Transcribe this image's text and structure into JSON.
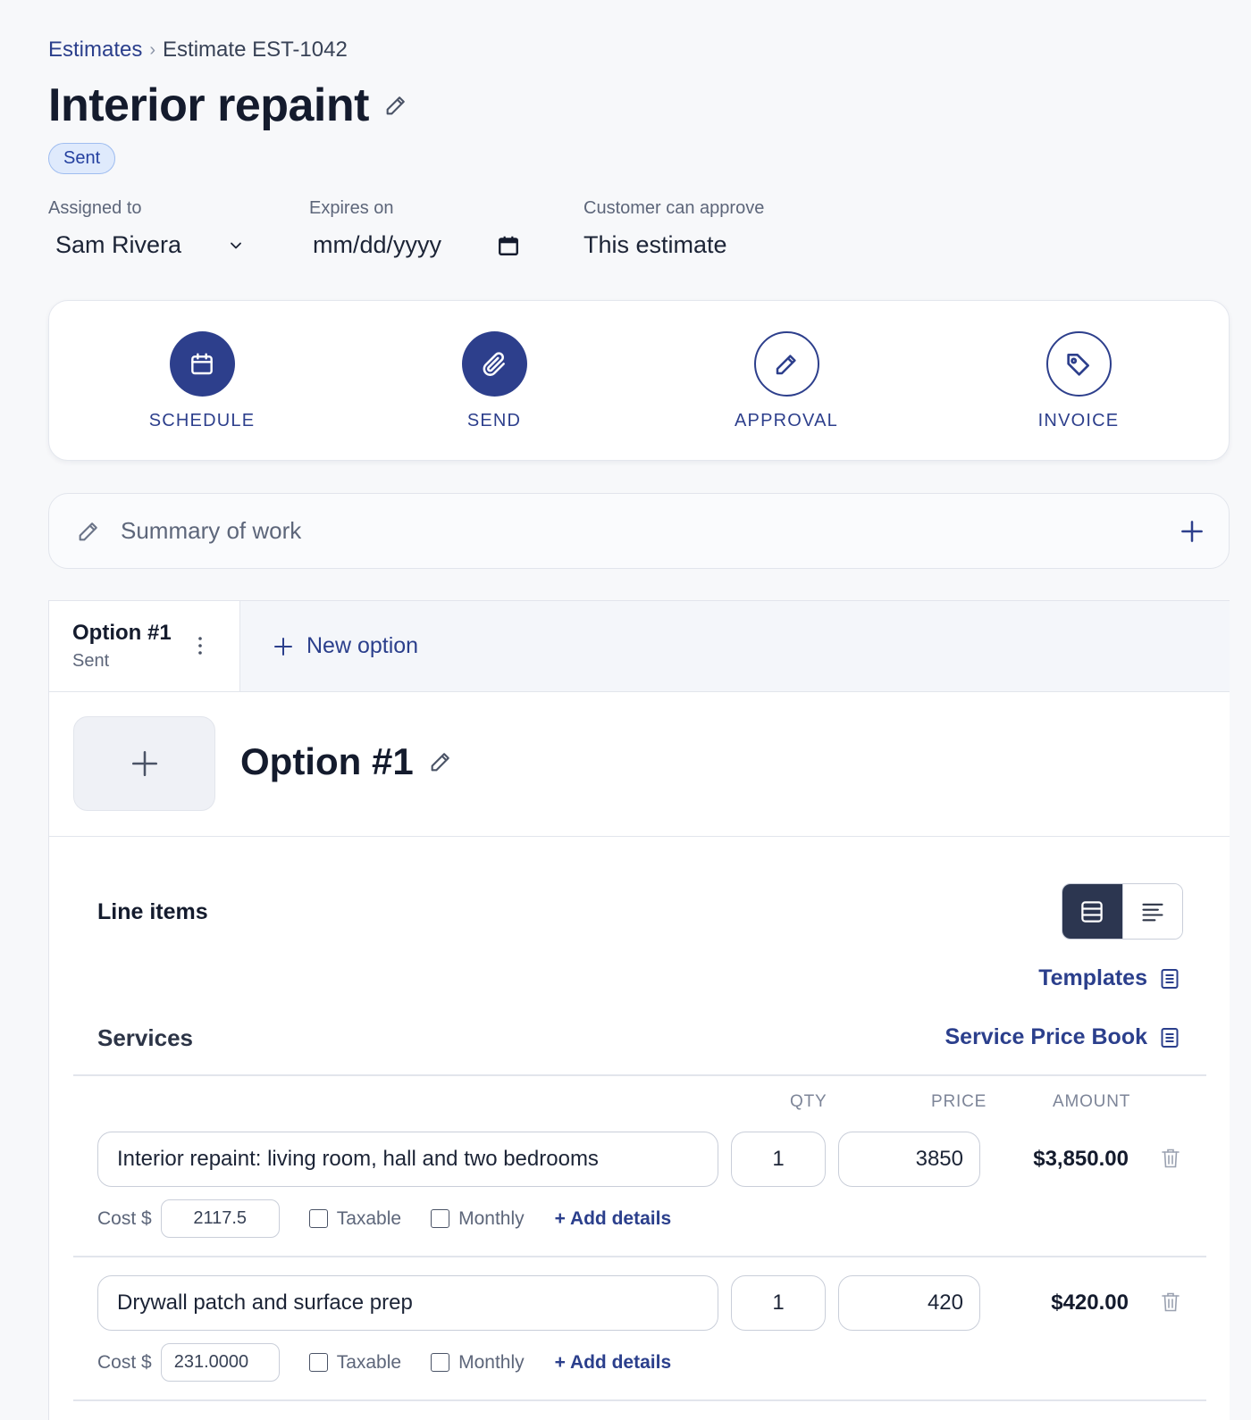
{
  "breadcrumb": {
    "parent": "Estimates",
    "separator": "›",
    "current": "Estimate EST-1042"
  },
  "page_title": "Interior repaint",
  "status": "Sent",
  "meta": {
    "assigned_label": "Assigned to",
    "assigned_value": "Sam Rivera",
    "expires_label": "Expires on",
    "expires_placeholder": "mm/dd/yyyy",
    "approve_label": "Customer can approve",
    "approve_value": "This estimate"
  },
  "actions": [
    {
      "label": "SCHEDULE",
      "icon": "calendar-icon"
    },
    {
      "label": "SEND",
      "icon": "paperclip-icon"
    },
    {
      "label": "APPROVAL",
      "icon": "pencil-icon"
    },
    {
      "label": "INVOICE",
      "icon": "tag-icon"
    }
  ],
  "summary": {
    "placeholder": "Summary of work"
  },
  "tabs": {
    "active": {
      "name": "Option #1",
      "status": "Sent"
    },
    "new_option": "New option"
  },
  "option": {
    "title": "Option #1"
  },
  "line_items": {
    "label": "Line items",
    "templates_link": "Templates",
    "services_label": "Services",
    "price_book_link": "Service Price Book",
    "columns": {
      "qty": "QTY",
      "price": "PRICE",
      "amount": "AMOUNT"
    },
    "items": [
      {
        "name": "Interior repaint: living room, hall and two bedrooms",
        "qty": "1",
        "price": "3850",
        "amount": "$3,850.00",
        "cost_label": "Cost $",
        "cost": "2117.5",
        "taxable_label": "Taxable",
        "monthly_label": "Monthly",
        "add_details": "+ Add details"
      },
      {
        "name": "Drywall patch and surface prep",
        "qty": "1",
        "price": "420",
        "amount": "$420.00",
        "cost_label": "Cost $",
        "cost": "231.0000",
        "taxable_label": "Taxable",
        "monthly_label": "Monthly",
        "add_details": "+ Add details"
      }
    ]
  },
  "colors": {
    "primary": "#2d3f8c",
    "dark_toggle": "#2c3650",
    "badge_bg": "#dfeafc"
  }
}
